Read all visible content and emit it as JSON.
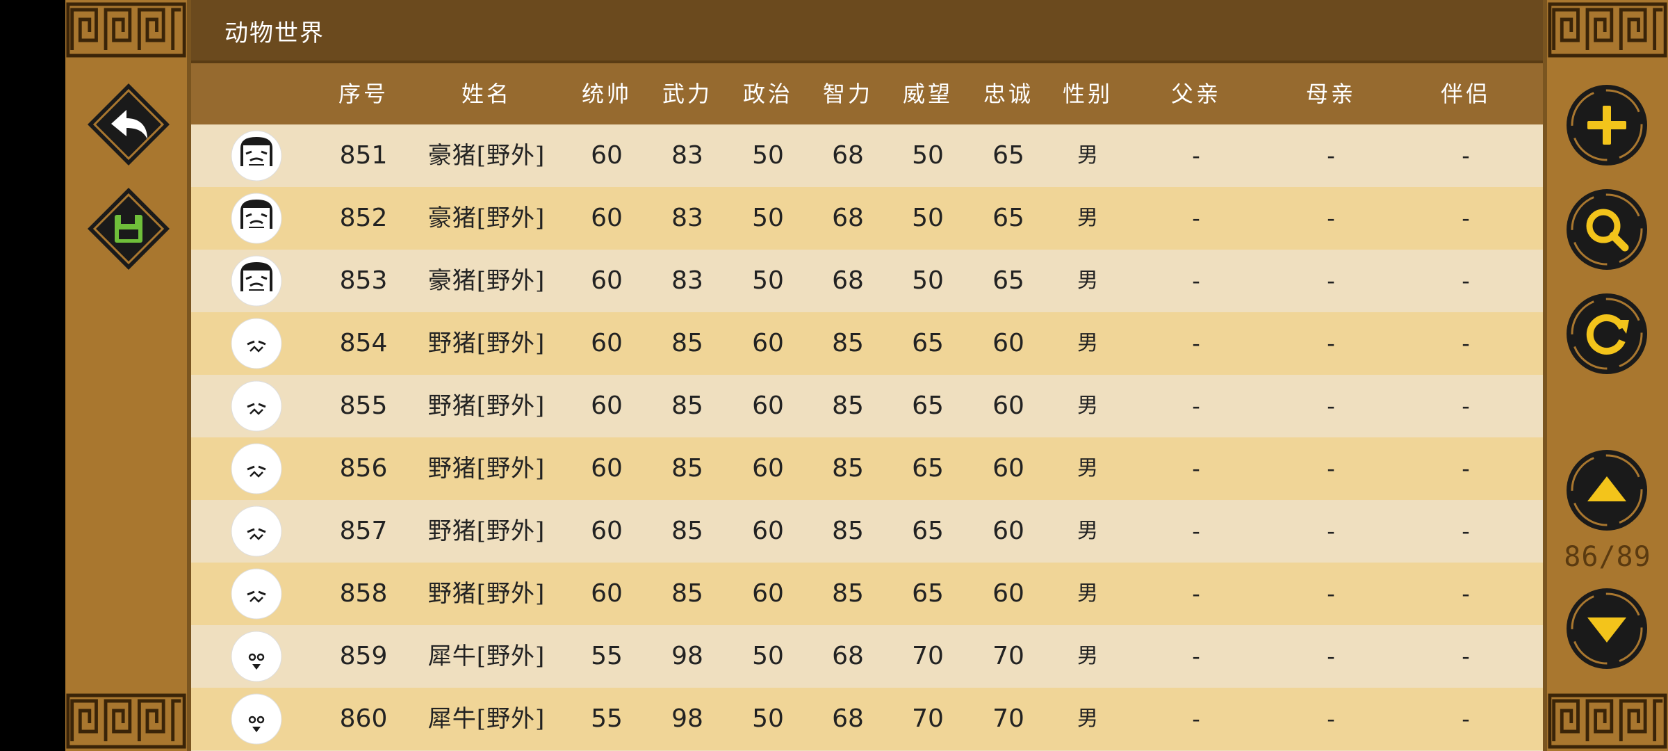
{
  "title": "动物世界",
  "page_indicator": "86/89",
  "left_buttons": [
    {
      "name": "back-button",
      "icon": "undo-arrow-icon"
    },
    {
      "name": "save-button",
      "icon": "floppy-disk-icon"
    }
  ],
  "right_buttons": [
    {
      "name": "add-button",
      "icon": "plus-icon"
    },
    {
      "name": "search-button",
      "icon": "magnifier-icon"
    },
    {
      "name": "refresh-button",
      "icon": "refresh-icon"
    },
    {
      "name": "page-up-button",
      "icon": "triangle-up-icon"
    },
    {
      "name": "page-down-button",
      "icon": "triangle-down-icon"
    }
  ],
  "columns": [
    "序号",
    "姓名",
    "统帅",
    "武力",
    "政治",
    "智力",
    "威望",
    "忠诚",
    "性别",
    "父亲",
    "母亲",
    "伴侣"
  ],
  "rows": [
    {
      "avatar": "boar-face-icon",
      "id": "851",
      "name": "豪猪[野外]",
      "cmd": "60",
      "str": "83",
      "pol": "50",
      "int": "68",
      "pres": "50",
      "loy": "65",
      "gender": "男",
      "father": "-",
      "mother": "-",
      "partner": "-"
    },
    {
      "avatar": "boar-face-icon",
      "id": "852",
      "name": "豪猪[野外]",
      "cmd": "60",
      "str": "83",
      "pol": "50",
      "int": "68",
      "pres": "50",
      "loy": "65",
      "gender": "男",
      "father": "-",
      "mother": "-",
      "partner": "-"
    },
    {
      "avatar": "boar-face-icon",
      "id": "853",
      "name": "豪猪[野外]",
      "cmd": "60",
      "str": "83",
      "pol": "50",
      "int": "68",
      "pres": "50",
      "loy": "65",
      "gender": "男",
      "father": "-",
      "mother": "-",
      "partner": "-"
    },
    {
      "avatar": "pig-face-icon",
      "id": "854",
      "name": "野猪[野外]",
      "cmd": "60",
      "str": "85",
      "pol": "60",
      "int": "85",
      "pres": "65",
      "loy": "60",
      "gender": "男",
      "father": "-",
      "mother": "-",
      "partner": "-"
    },
    {
      "avatar": "pig-face-icon",
      "id": "855",
      "name": "野猪[野外]",
      "cmd": "60",
      "str": "85",
      "pol": "60",
      "int": "85",
      "pres": "65",
      "loy": "60",
      "gender": "男",
      "father": "-",
      "mother": "-",
      "partner": "-"
    },
    {
      "avatar": "pig-face-icon",
      "id": "856",
      "name": "野猪[野外]",
      "cmd": "60",
      "str": "85",
      "pol": "60",
      "int": "85",
      "pres": "65",
      "loy": "60",
      "gender": "男",
      "father": "-",
      "mother": "-",
      "partner": "-"
    },
    {
      "avatar": "pig-face-icon",
      "id": "857",
      "name": "野猪[野外]",
      "cmd": "60",
      "str": "85",
      "pol": "60",
      "int": "85",
      "pres": "65",
      "loy": "60",
      "gender": "男",
      "father": "-",
      "mother": "-",
      "partner": "-"
    },
    {
      "avatar": "pig-face-icon",
      "id": "858",
      "name": "野猪[野外]",
      "cmd": "60",
      "str": "85",
      "pol": "60",
      "int": "85",
      "pres": "65",
      "loy": "60",
      "gender": "男",
      "father": "-",
      "mother": "-",
      "partner": "-"
    },
    {
      "avatar": "rhino-face-icon",
      "id": "859",
      "name": "犀牛[野外]",
      "cmd": "55",
      "str": "98",
      "pol": "50",
      "int": "68",
      "pres": "70",
      "loy": "70",
      "gender": "男",
      "father": "-",
      "mother": "-",
      "partner": "-"
    },
    {
      "avatar": "rhino-face-icon",
      "id": "860",
      "name": "犀牛[野外]",
      "cmd": "55",
      "str": "98",
      "pol": "50",
      "int": "68",
      "pres": "70",
      "loy": "70",
      "gender": "男",
      "father": "-",
      "mother": "-",
      "partner": "-"
    }
  ],
  "colors": {
    "panel": "#a9772f",
    "titlebar": "#6b4a1e",
    "header": "#966a2f",
    "row_light": "#efdfbf",
    "row_dark": "#f0d597",
    "save_green": "#6fbf3a"
  }
}
